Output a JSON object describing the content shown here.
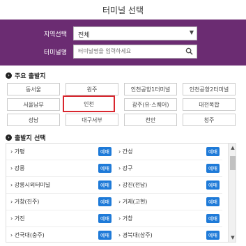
{
  "page": {
    "title": "터미널 선택"
  },
  "filter": {
    "region_label": "지역선택",
    "region_value": "전체",
    "terminal_label": "터미널명",
    "terminal_placeholder": "터미널명을 입력하세요"
  },
  "major": {
    "heading": "주요 출발지",
    "terminals": [
      "동서울",
      "원주",
      "인천공항1터미널",
      "인천공항2터미널",
      "서울남부",
      "인천",
      "광주(유·스퀘어)",
      "대전복합",
      "성남",
      "대구서부",
      "천안",
      "청주"
    ],
    "selected": "인천"
  },
  "departure": {
    "heading": "출발지 선택",
    "book_label": "예매",
    "rows": [
      [
        "가평",
        "간성"
      ],
      [
        "강릉",
        "강구"
      ],
      [
        "강릉시외터미널",
        "강진(전남)"
      ],
      [
        "거창(진주)",
        "거제(고현)"
      ],
      [
        "거진",
        "거창"
      ],
      [
        "건국대(충주)",
        "경북대(상주)"
      ]
    ]
  },
  "colors": {
    "header": "#6b2c72",
    "selected_border": "#d9262e",
    "book_button": "#1e7ad8"
  }
}
